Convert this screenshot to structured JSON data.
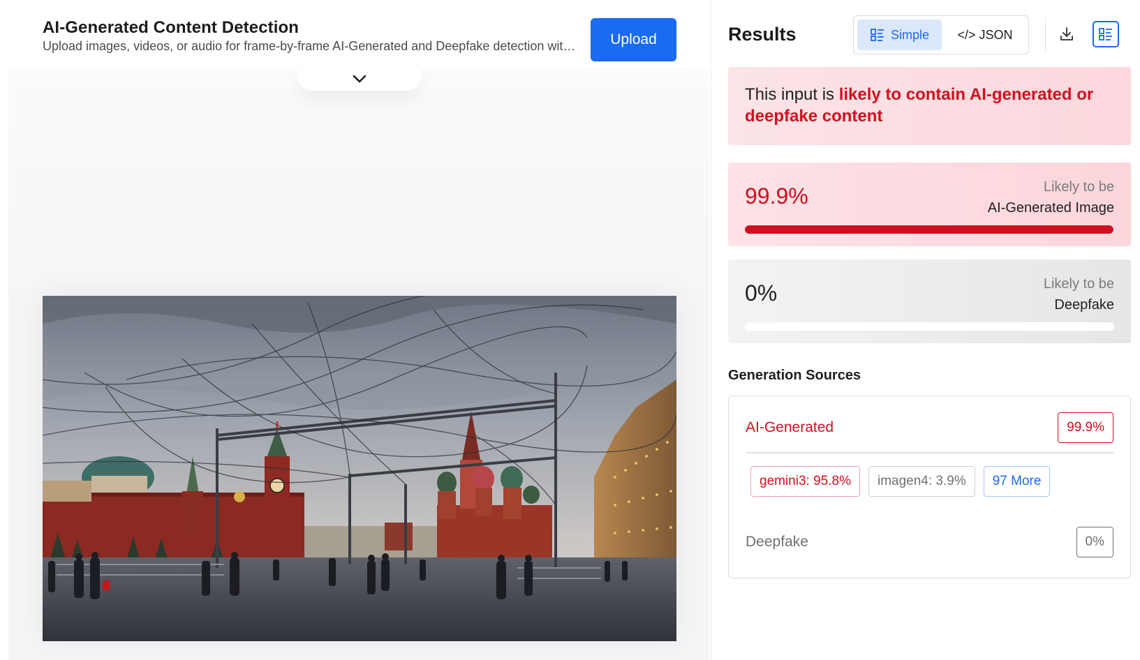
{
  "app": {
    "title": "AI-Generated Content Detection",
    "subtitle": "Upload images, videos, or audio for frame-by-frame AI-Generated and Deepfake detection with...",
    "upload_label": "Upload"
  },
  "preview": {
    "icon": "chevron-down-icon",
    "image_icon": "photo-red-square"
  },
  "results": {
    "title": "Results",
    "view_toggle": {
      "simple_label": "Simple",
      "json_label": "</> JSON",
      "active": "Simple"
    },
    "actions": {
      "download_icon": "download-icon",
      "list_icon": "list-view-icon"
    },
    "verdict": {
      "prefix": "This input is ",
      "highlight": "likely to contain AI-generated or deepfake content"
    },
    "cards": [
      {
        "percent": "99.9%",
        "value": 0.999,
        "likely_label": "Likely to be",
        "category": "AI-Generated Image"
      },
      {
        "percent": "0%",
        "value": 0.0,
        "likely_label": "Likely to be",
        "category": "Deepfake"
      }
    ],
    "generation_sources": {
      "title": "Generation Sources",
      "ai_generated": {
        "label": "AI-Generated",
        "percent": "99.9%",
        "chips": [
          {
            "label": "gemini3: 95.8%"
          },
          {
            "label": "imagen4: 3.9%"
          },
          {
            "label": "97 More"
          }
        ]
      },
      "deepfake": {
        "label": "Deepfake",
        "percent": "0%"
      }
    }
  },
  "colors": {
    "accent_blue": "#1a6af2",
    "alert_red": "#d0101f",
    "neutral_grey": "#707070"
  }
}
